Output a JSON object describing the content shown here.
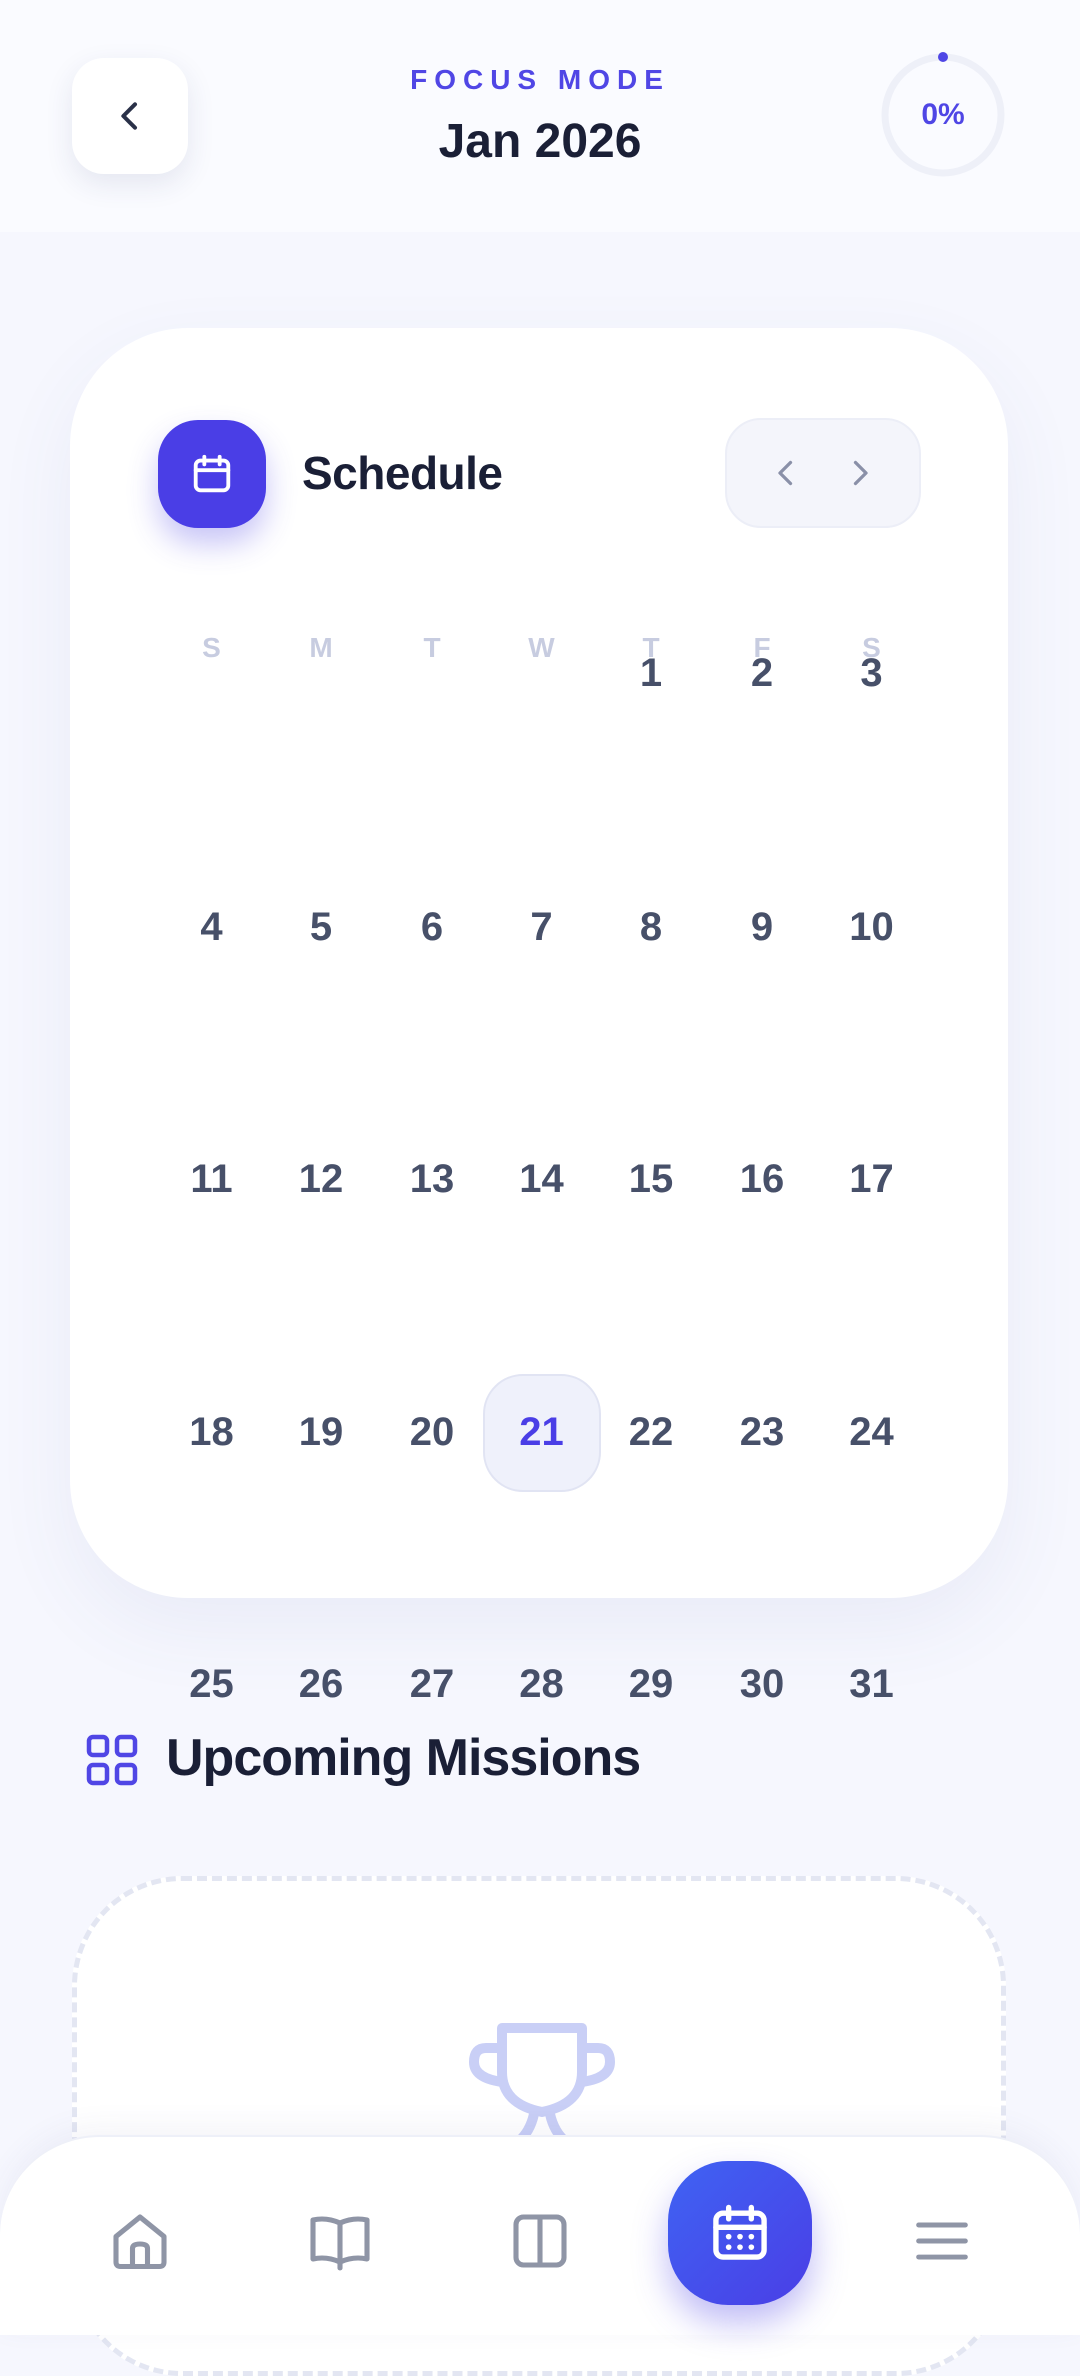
{
  "header": {
    "subtitle": "FOCUS MODE",
    "title": "Jan 2026",
    "progress_text": "0%",
    "progress_value": 0,
    "accent_color": "#4f46e5"
  },
  "calendar": {
    "title": "Schedule",
    "weekdays": [
      "S",
      "M",
      "T",
      "W",
      "T",
      "F",
      "S"
    ],
    "first_weekday_index": 4,
    "days_in_month": 31,
    "today": 21,
    "badge_color": "#4a3ee6",
    "icons": {
      "badge": "calendar-icon",
      "prev": "chevron-left-icon",
      "next": "chevron-right-icon"
    }
  },
  "upcoming": {
    "title": "Upcoming Missions",
    "icon": "grid-icon",
    "empty_icon": "trophy-icon"
  },
  "bottom_nav": {
    "items": [
      {
        "icon": "home-icon",
        "active": false
      },
      {
        "icon": "book-icon",
        "active": false
      },
      {
        "icon": "columns-icon",
        "active": false
      },
      {
        "icon": "calendar-icon",
        "active": true
      },
      {
        "icon": "menu-icon",
        "active": false
      }
    ]
  }
}
